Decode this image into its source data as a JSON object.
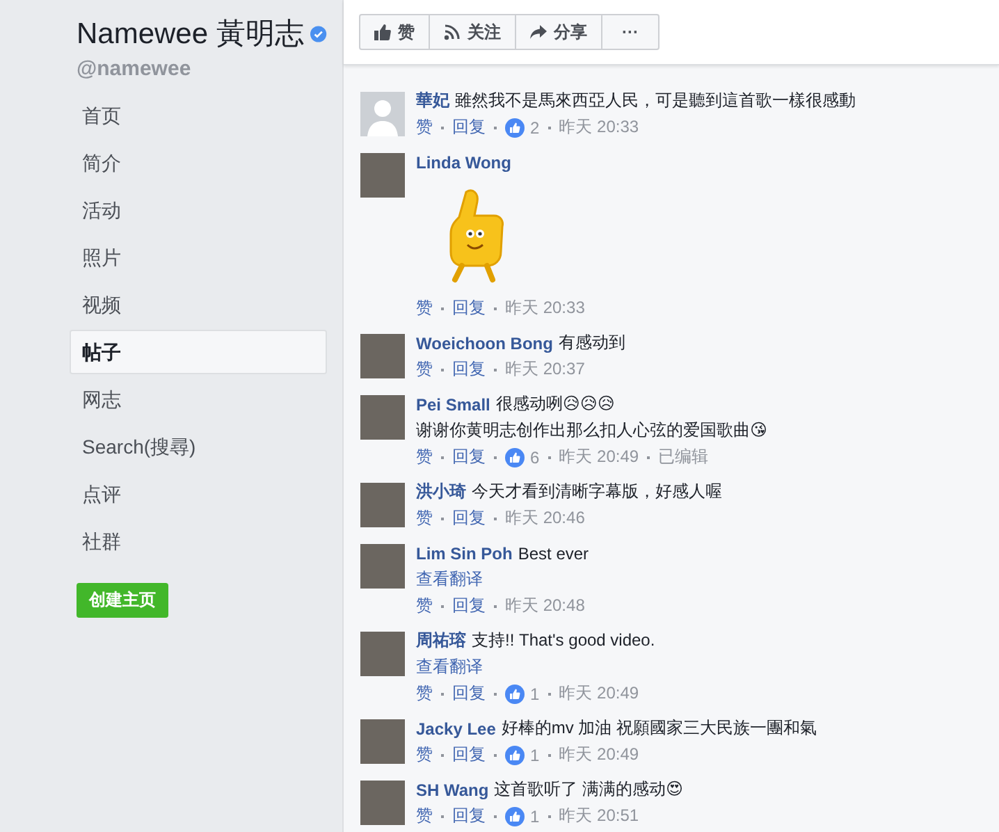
{
  "page": {
    "name": "Namewee 黃明志",
    "verified": true,
    "handle": "@namewee"
  },
  "nav": [
    {
      "label": "首页",
      "selected": false
    },
    {
      "label": "简介",
      "selected": false
    },
    {
      "label": "活动",
      "selected": false
    },
    {
      "label": "照片",
      "selected": false
    },
    {
      "label": "视频",
      "selected": false
    },
    {
      "label": "帖子",
      "selected": true
    },
    {
      "label": "网志",
      "selected": false
    },
    {
      "label": "Search(搜尋)",
      "selected": false
    },
    {
      "label": "点评",
      "selected": false
    },
    {
      "label": "社群",
      "selected": false
    }
  ],
  "create_page_button": "创建主页",
  "actions": [
    {
      "kind": "like",
      "label": "赞"
    },
    {
      "kind": "follow",
      "label": "关注"
    },
    {
      "kind": "share",
      "label": "分享"
    },
    {
      "kind": "more",
      "label": "···"
    }
  ],
  "comments": [
    {
      "name": "華妃",
      "kind": "default",
      "lines": [
        "雖然我不是馬來西亞人民，可是聽到這首歌一樣很感動"
      ],
      "like": "赞",
      "reply": "回复",
      "reactions": "2",
      "time": "昨天 20:33"
    },
    {
      "name": "Linda Wong",
      "kind": "photo",
      "sticker": true,
      "like": "赞",
      "reply": "回复",
      "time": "昨天 20:33"
    },
    {
      "name": "Woeichoon Bong",
      "kind": "photo",
      "lines": [
        "有感动到"
      ],
      "like": "赞",
      "reply": "回复",
      "time": "昨天 20:37"
    },
    {
      "name": "Pei Small",
      "kind": "photo",
      "lines": [
        "很感动咧😥😥😥",
        "谢谢你黄明志创作出那么扣人心弦的爱国歌曲😘"
      ],
      "like": "赞",
      "reply": "回复",
      "reactions": "6",
      "time": "昨天 20:49",
      "edited": "已编辑"
    },
    {
      "name": "洪小琦",
      "kind": "photo",
      "lines": [
        "今天才看到清晰字幕版，好感人喔"
      ],
      "like": "赞",
      "reply": "回复",
      "time": "昨天 20:46"
    },
    {
      "name": "Lim Sin Poh",
      "kind": "photo",
      "lines": [
        "Best ever"
      ],
      "translate": "查看翻译",
      "like": "赞",
      "reply": "回复",
      "time": "昨天 20:48"
    },
    {
      "name": "周祐瑢",
      "kind": "photo",
      "lines": [
        "支持!! That's good video."
      ],
      "translate": "查看翻译",
      "like": "赞",
      "reply": "回复",
      "reactions": "1",
      "time": "昨天 20:49"
    },
    {
      "name": "Jacky Lee",
      "kind": "photo",
      "lines": [
        "好棒的mv 加油 祝願國家三大民族一團和氣"
      ],
      "like": "赞",
      "reply": "回复",
      "reactions": "1",
      "time": "昨天 20:49"
    },
    {
      "name": "SH Wang",
      "kind": "photo",
      "lines": [
        "这首歌听了 满满的感动😍"
      ],
      "like": "赞",
      "reply": "回复",
      "reactions": "1",
      "time": "昨天 20:51"
    }
  ]
}
